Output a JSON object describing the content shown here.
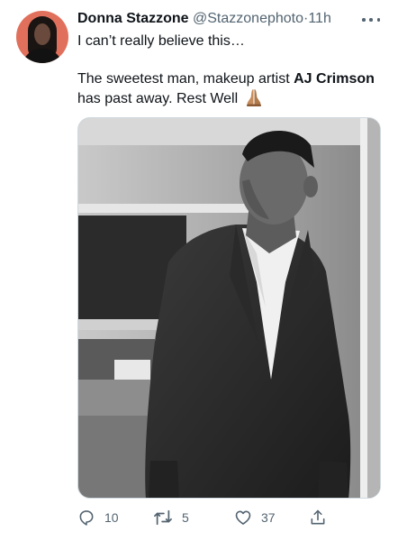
{
  "tweet": {
    "author_name": "Donna Stazzone",
    "handle": "@Stazzonephoto",
    "separator": "·",
    "time": "11h",
    "line1": "I can’t really believe this…",
    "line2_prefix": "The sweetest man, makeup artist ",
    "line2_bold": "AJ Crimson",
    "line2_suffix": " has past away. Rest Well "
  },
  "actions": {
    "replies": "10",
    "retweets": "5",
    "likes": "37"
  },
  "icons": [
    "more-icon",
    "pray-emoji-icon",
    "reply-icon",
    "retweet-icon",
    "like-icon",
    "share-icon"
  ],
  "colors": {
    "text": "#0f1419",
    "secondary": "#536471",
    "avatar_bg": "#e0705c"
  }
}
